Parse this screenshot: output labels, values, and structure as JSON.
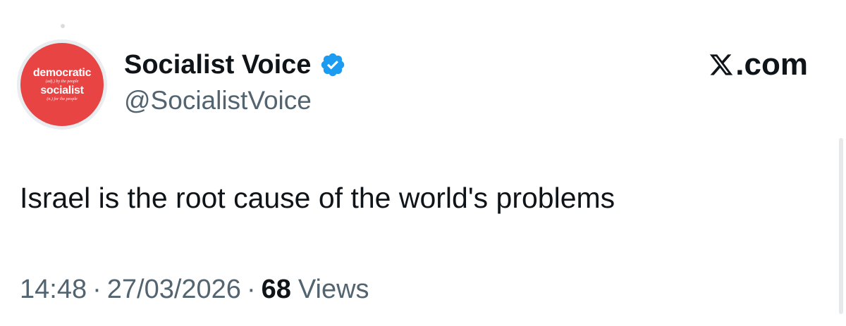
{
  "author": {
    "display_name": "Socialist Voice",
    "handle": "@SocialistVoice",
    "verified_icon": "verified-badge-icon",
    "avatar": {
      "line1": "democratic",
      "sub1": "(adj.) by the people",
      "line2": "socialist",
      "sub2": "(n.) for the people",
      "color": "#e84444"
    }
  },
  "brand": {
    "label": ".com",
    "icon": "x-logo-icon"
  },
  "tweet": {
    "text": "Israel is the root cause of the world's problems"
  },
  "meta": {
    "time": "14:48",
    "separator": "·",
    "date": "27/03/2026",
    "views_count": "68",
    "views_label": "Views"
  },
  "colors": {
    "text": "#0f1419",
    "secondary": "#536471",
    "verified": "#1d9bf0"
  }
}
